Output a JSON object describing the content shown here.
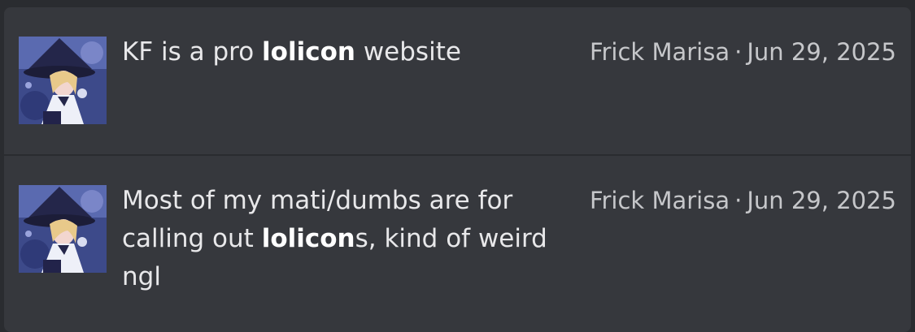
{
  "results": [
    {
      "snippet_parts": [
        "KF is a pro ",
        "lolicon",
        " website"
      ],
      "author": "Frick Marisa",
      "separator": "·",
      "date": "Jun 29, 2025"
    },
    {
      "snippet_parts": [
        "Most of my mati/dumbs are for calling out ",
        "lolicon",
        "s, kind of weird ngl"
      ],
      "author": "Frick Marisa",
      "separator": "·",
      "date": "Jun 29, 2025"
    }
  ],
  "colors": {
    "page_background": "#2a2c30",
    "card_background": "#36383d",
    "text": "#e8e8ea",
    "meta_text": "#c6c7ca"
  }
}
